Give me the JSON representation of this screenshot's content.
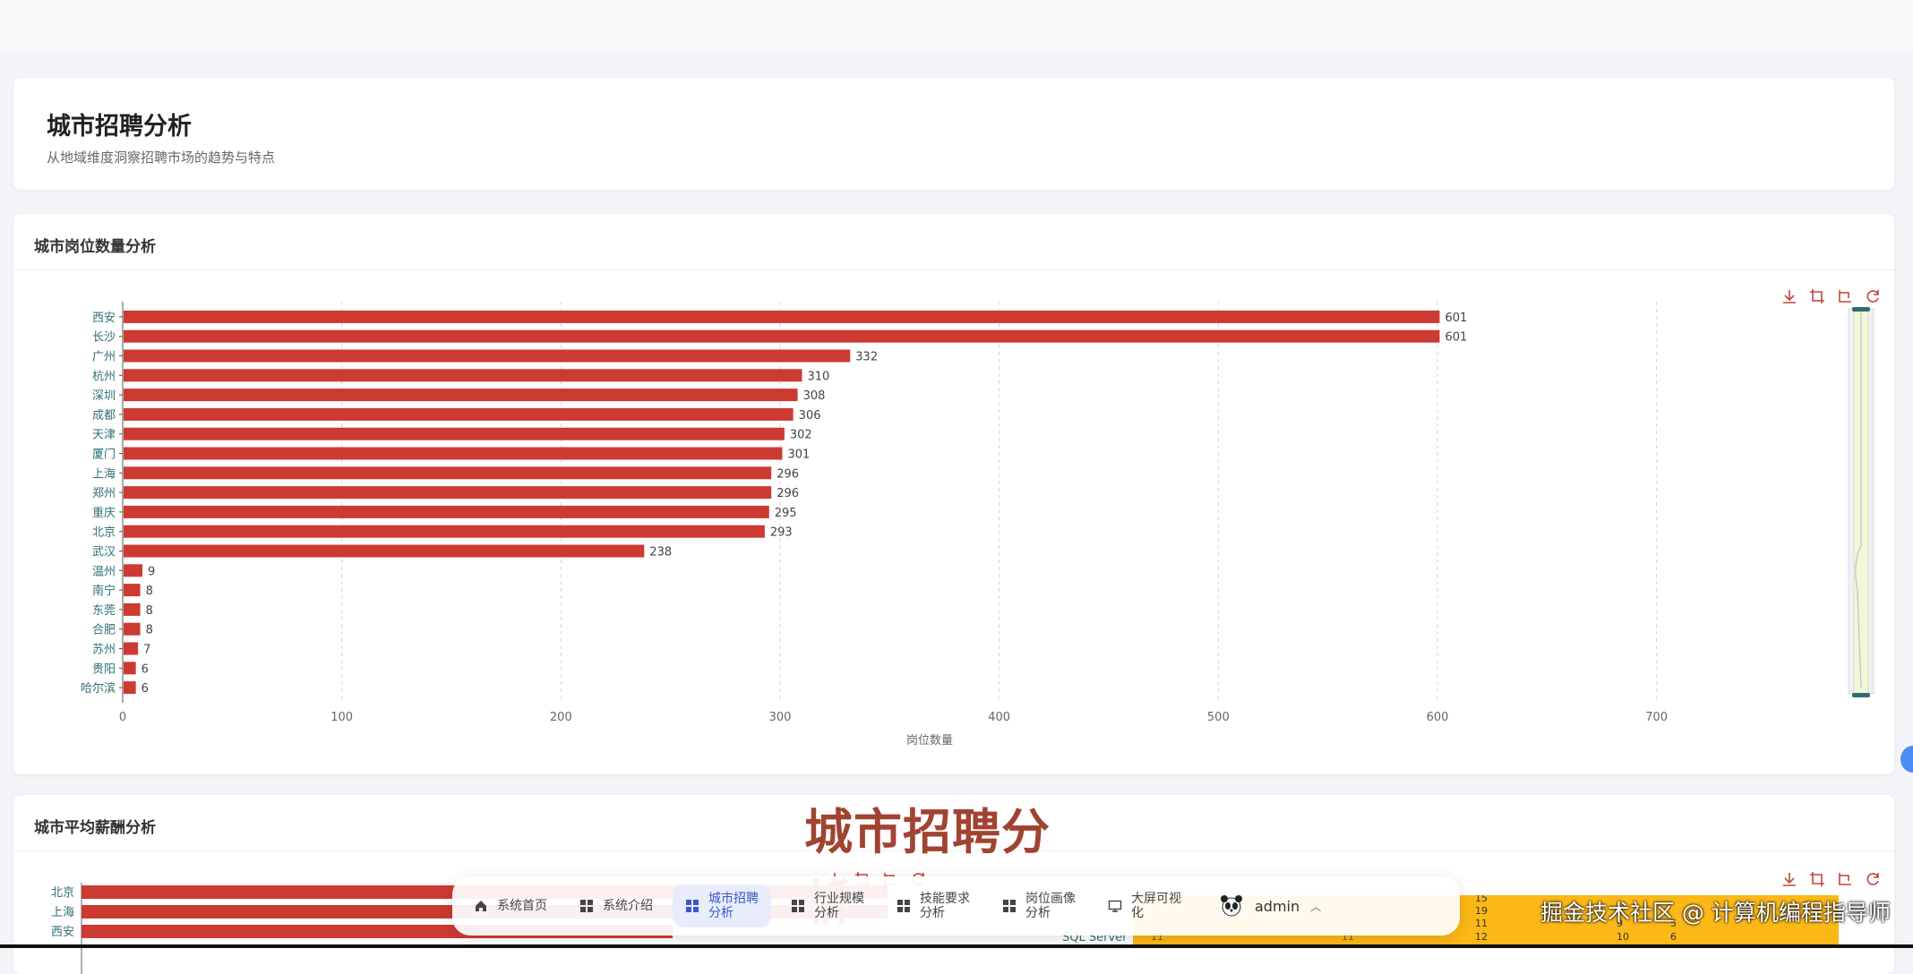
{
  "page": {
    "title": "城市招聘分析",
    "subtitle": "从地域维度洞察招聘市场的趋势与特点"
  },
  "card1": {
    "title": "城市岗位数量分析"
  },
  "card2": {
    "title": "城市平均薪酬分析",
    "categories_partial": [
      "北京",
      "上海",
      "西安"
    ]
  },
  "overlay": {
    "title": "城市招聘分析",
    "ghost": "析"
  },
  "chart_data": {
    "type": "bar",
    "orientation": "horizontal",
    "categories": [
      "西安",
      "长沙",
      "广州",
      "杭州",
      "深圳",
      "成都",
      "天津",
      "厦门",
      "上海",
      "郑州",
      "重庆",
      "北京",
      "武汉",
      "温州",
      "南宁",
      "东莞",
      "合肥",
      "苏州",
      "贵阳",
      "哈尔滨"
    ],
    "values": [
      601,
      601,
      332,
      310,
      308,
      306,
      302,
      301,
      296,
      296,
      295,
      293,
      238,
      9,
      8,
      8,
      8,
      7,
      6,
      6
    ],
    "xlabel": "岗位数量",
    "xlim": [
      0,
      750
    ],
    "xticks": [
      0,
      100,
      200,
      300,
      400,
      500,
      600,
      700
    ],
    "grid": true,
    "data_labels": true,
    "color": "#cc3a32"
  },
  "right_table_partial": {
    "label": "SQL Server",
    "numbers": [
      "15",
      "19",
      "11",
      "12",
      "5",
      "11",
      "9",
      "10",
      "5",
      "6"
    ]
  },
  "toolbox": [
    "download-icon",
    "zoom-icon",
    "zoom-back-icon",
    "restore-icon"
  ],
  "dock": {
    "items": [
      {
        "label": "系统首页",
        "icon": "home-icon"
      },
      {
        "label": "系统介绍",
        "icon": "grid-icon"
      },
      {
        "label": "城市招聘分析",
        "icon": "grid-icon",
        "active": true
      },
      {
        "label": "行业规模分析",
        "icon": "grid-icon"
      },
      {
        "label": "技能要求分析",
        "icon": "grid-icon"
      },
      {
        "label": "岗位画像分析",
        "icon": "grid-icon"
      },
      {
        "label": "大屏可视化",
        "icon": "screen-icon"
      }
    ],
    "user": "admin"
  },
  "watermark": "掘金技术社区 @ 计算机编程指导师",
  "colors": {
    "bar": "#cc3a32",
    "accent": "#3a58c9",
    "axis_label": "#2f6f74"
  }
}
